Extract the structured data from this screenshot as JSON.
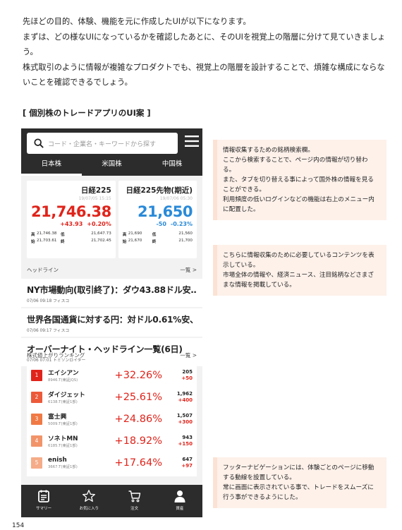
{
  "intro": {
    "p1": "先ほどの目的、体験、機能を元に作成したUIが以下になります。",
    "p2": "まずは、どの様なUIになっているかを確認したあとに、そのUIを視覚上の階層に分けて見ていきましょう。",
    "p3": "株式取引のように情報が複雑なプロダクトでも、視覚上の階層を設計することで、煩雑な構成にならないことを確認できるでしょう。"
  },
  "section_title": "[ 個別株のトレードアプリのUI案 ]",
  "app": {
    "search_placeholder": "コード・企業名・キーワードから探す",
    "tabs": [
      "日本株",
      "米国株",
      "中国株"
    ],
    "indices": [
      {
        "name": "日経225",
        "date": "19/07/05 15:15",
        "price": "21,746.38",
        "change": "+43.93",
        "pct": "+0.20%",
        "color": "#e0241b",
        "high_label": "高",
        "high": "21,746.38",
        "low_label": "低",
        "low": "21,647.73",
        "open_label": "始",
        "open": "21,703.61",
        "close_label": "終",
        "close": "21,702.45"
      },
      {
        "name": "日経225先物(期近)",
        "date": "19/07/06 05:30",
        "price": "21,650",
        "change": "-50",
        "pct": "-0.23%",
        "color": "#2a8ad8",
        "high_label": "高",
        "high": "21,690",
        "low_label": "低",
        "low": "21,560",
        "open_label": "始",
        "open": "21,670",
        "close_label": "終",
        "close": "21,700"
      }
    ],
    "headline_section": {
      "label": "ヘッドライン",
      "more": "一覧 >"
    },
    "news": [
      {
        "title": "NY市場動向(取引終了)：ダウ43.88ドル安…",
        "meta": "07/06 09:18 フィスコ"
      },
      {
        "title": "世界各国通貨に対する円：対ドル0.61%安、…",
        "meta": "07/06 09:17 フィスコ"
      },
      {
        "title": "オーバーナイト・ヘッドライン一覧(6日)",
        "meta": "07/06 07:01 トミソンロイター"
      }
    ],
    "ranking_section": {
      "label": "株式値上がりランキング",
      "more": "一覧 >"
    },
    "ranking": [
      {
        "rank": "1",
        "name": "エイシアン",
        "code": "8946.T(東証JQS)",
        "pct": "+32.26%",
        "price": "205",
        "diff": "+50",
        "color": "#e0241b"
      },
      {
        "rank": "2",
        "name": "ダイジェット",
        "code": "6138.T(東証1部)",
        "pct": "+25.61%",
        "price": "1,962",
        "diff": "+400",
        "color": "#ec5a3a"
      },
      {
        "rank": "3",
        "name": "富士興",
        "code": "5009.T(東証1部)",
        "pct": "+24.86%",
        "price": "1,507",
        "diff": "+300",
        "color": "#f07a45"
      },
      {
        "rank": "4",
        "name": "ソネトMN",
        "code": "6185.T(東証1部)",
        "pct": "+18.92%",
        "price": "943",
        "diff": "+150",
        "color": "#f2946a"
      },
      {
        "rank": "5",
        "name": "enish",
        "code": "3667.T(東証1部)",
        "pct": "+17.64%",
        "price": "647",
        "diff": "+97",
        "color": "#f5ac88"
      }
    ],
    "footer": [
      "サマリー",
      "お気に入り",
      "注文",
      "資産"
    ]
  },
  "notes": {
    "n1": [
      "情報収集するための銘柄検索欄。",
      "ここから検索することで、ページ内の情報が切り替わる。",
      "また、タブを切り替える事によって国外株の情報を見ることができる。",
      "利用頻度の低いログインなどの機能は右上のメニュー内に配置した。"
    ],
    "n2": [
      "こちらに情報収集のために必要しているコンテンツを表示している。",
      "市場全体の情報や、経済ニュース、注目銘柄などさまざまな情報を掲載している。"
    ],
    "n3": [
      "フッターナビゲーションには、体験ごとのページに移動する動線を設置している。",
      "常に画面に表示されている事で、トレードをスムーズに行う事ができるようにした。"
    ]
  },
  "page_number": "154"
}
